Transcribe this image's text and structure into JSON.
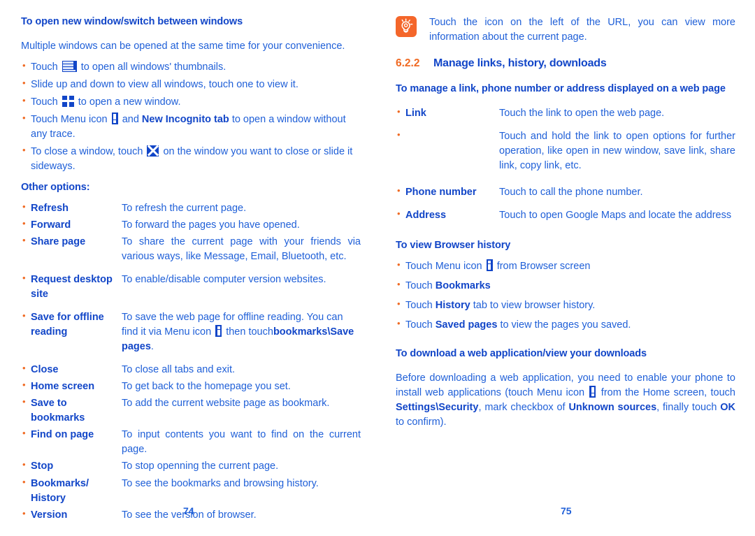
{
  "left_page": {
    "heading": "To open new window/switch between windows",
    "intro": "Multiple windows can be opened at the same time for your convenience.",
    "bullets": {
      "b1_pre": "Touch",
      "b1_post": "to open all windows' thumbnails.",
      "b2": "Slide up and down to view all windows, touch one to view it.",
      "b3_pre": "Touch",
      "b3_post": "to open a new window.",
      "b4_pre": "Touch Menu icon",
      "b4_mid": "and",
      "b4_bold": "New Incognito tab",
      "b4_post": "to open a window without any trace.",
      "b5_pre": "To close a window, touch",
      "b5_post": "on the window you want to close or slide it sideways."
    },
    "other_options_heading": "Other options:",
    "options": [
      {
        "term": "Refresh",
        "desc": "To refresh the current page."
      },
      {
        "term": "Forward",
        "desc": "To forward the pages you have opened."
      },
      {
        "term": "Share page",
        "desc": "To share the current page with your friends via various ways, like Message, Email, Bluetooth, etc."
      },
      {
        "term": "Request desktop site",
        "desc": "To enable/disable computer version websites."
      },
      {
        "term": "Close",
        "desc": "To close all tabs and exit."
      },
      {
        "term": "Home screen",
        "desc": "To get back to the homepage you set."
      },
      {
        "term": "Save to bookmarks",
        "desc": "To add the current website page as bookmark."
      },
      {
        "term": "Find on page",
        "desc": "To input contents you want to find on the current page."
      },
      {
        "term": "Stop",
        "desc": "To stop openning the current page."
      },
      {
        "term": "Bookmarks/ History",
        "desc": "To see the bookmarks and browsing history."
      },
      {
        "term": "Version",
        "desc": "To see the version of browser."
      }
    ],
    "save_offline": {
      "term": "Save for offline reading",
      "desc_pre": "To save the web page for offline reading. You can find it via Menu icon",
      "desc_mid": "then touch",
      "desc_bold": "bookmarks\\Save pages",
      "desc_post": "."
    },
    "page_number": "74"
  },
  "right_page": {
    "tip": {
      "icon": "lightbulb-icon",
      "text": "Touch the icon on the left of the URL, you can view more information about the current page."
    },
    "section": {
      "number": "6.2.2",
      "title": "Manage links, history, downloads"
    },
    "manage_heading": "To manage a link, phone number or address displayed on a web page",
    "link_rows": [
      {
        "term": "Link",
        "desc": "Touch the link to open the web page."
      },
      {
        "term": "",
        "desc": "Touch and hold the link to open options for further operation, like open in new window, save link, share link, copy link, etc."
      },
      {
        "term": "Phone number",
        "desc": "Touch to call the phone number."
      },
      {
        "term": "Address",
        "desc": "Touch to open Google Maps and locate the address"
      }
    ],
    "history_heading": "To view Browser history",
    "history_bullets": {
      "h1_pre": "Touch Menu icon",
      "h1_post": "from Browser screen",
      "h2_pre": "Touch",
      "h2_bold": "Bookmarks",
      "h3_pre": "Touch",
      "h3_bold": "History",
      "h3_post": "tab to view browser history.",
      "h4_pre": "Touch",
      "h4_bold": "Saved pages",
      "h4_post": "to view the pages you saved."
    },
    "download_heading": "To download a web application/view your downloads",
    "download_text": {
      "p1": "Before downloading a web application, you need to enable your phone to install web applications (touch Menu icon",
      "p2": "from the Home screen, touch",
      "b1": "Settings\\Security",
      "p3": ", mark checkbox of",
      "b2": "Unknown sources",
      "p4": ", finally touch",
      "b3": "OK",
      "p5": "to confirm)."
    },
    "page_number": "75"
  },
  "colors": {
    "body_blue": "#2060d8",
    "bold_blue": "#1246c8",
    "accent_orange": "#f06a23",
    "tip_bg": "#f4662a",
    "icon_blue": "#1246c8"
  }
}
